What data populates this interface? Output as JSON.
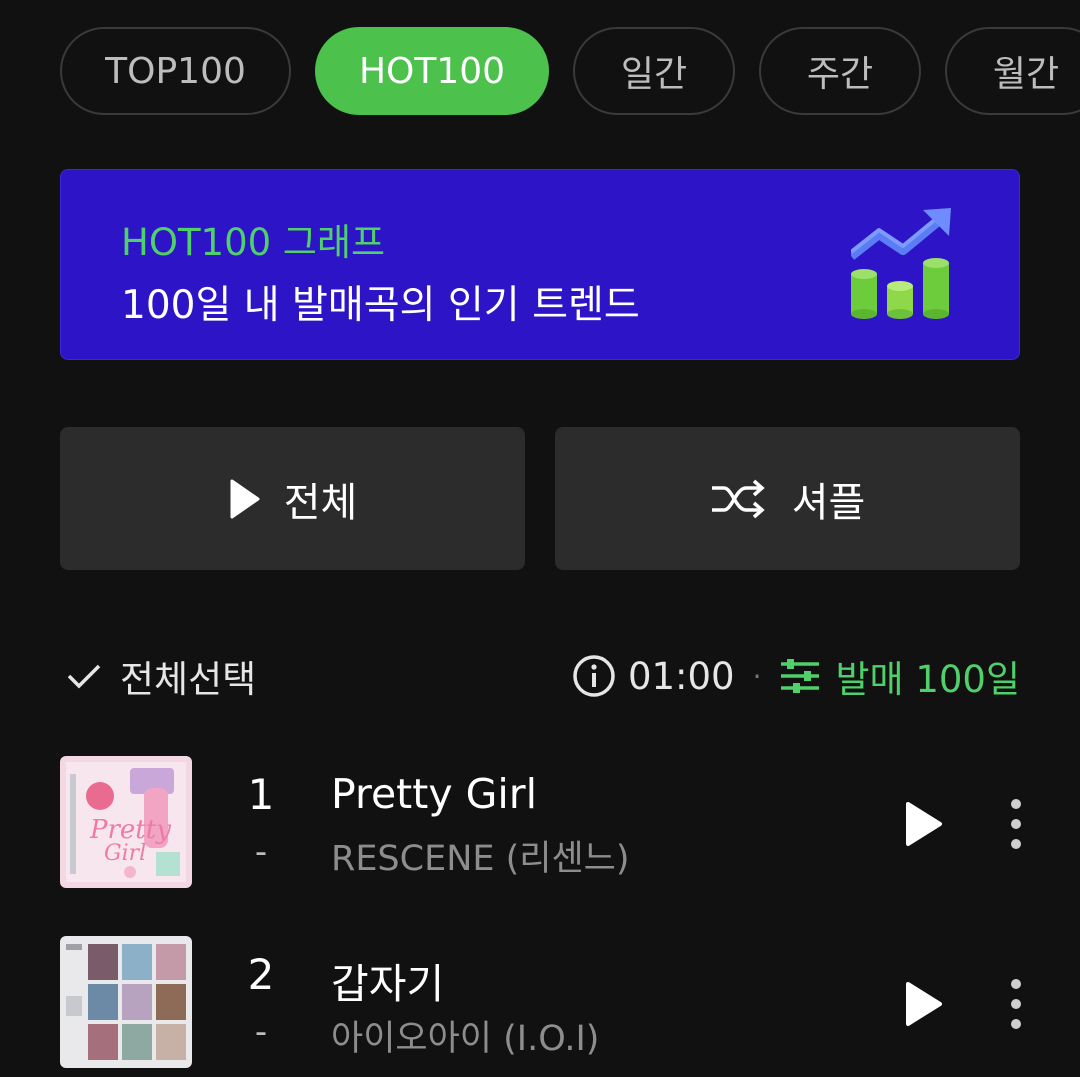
{
  "chips": [
    {
      "label": "TOP100",
      "active": false
    },
    {
      "label": "HOT100",
      "active": true
    },
    {
      "label": "일간",
      "active": false
    },
    {
      "label": "주간",
      "active": false
    },
    {
      "label": "월간",
      "active": false
    }
  ],
  "banner": {
    "title": "HOT100 그래프",
    "subtitle": "100일 내 발매곡의 인기 트렌드",
    "icon": "trend-chart-icon"
  },
  "buttons": {
    "play_all": "전체",
    "shuffle": "셔플"
  },
  "toolbar": {
    "select_all": "전체선택",
    "time": "01:00",
    "separator": "·",
    "filter": "발매 100일"
  },
  "songs": [
    {
      "rank": "1",
      "change": "-",
      "title": "Pretty Girl",
      "artist": "RESCENE (리센느)"
    },
    {
      "rank": "2",
      "change": "-",
      "title": "갑자기",
      "artist": "아이오아이 (I.O.I)"
    }
  ],
  "colors": {
    "background": "#111111",
    "accent_green": "#4cc24c",
    "banner_blue": "#2d14c6",
    "button_gray": "#2c2c2c"
  }
}
